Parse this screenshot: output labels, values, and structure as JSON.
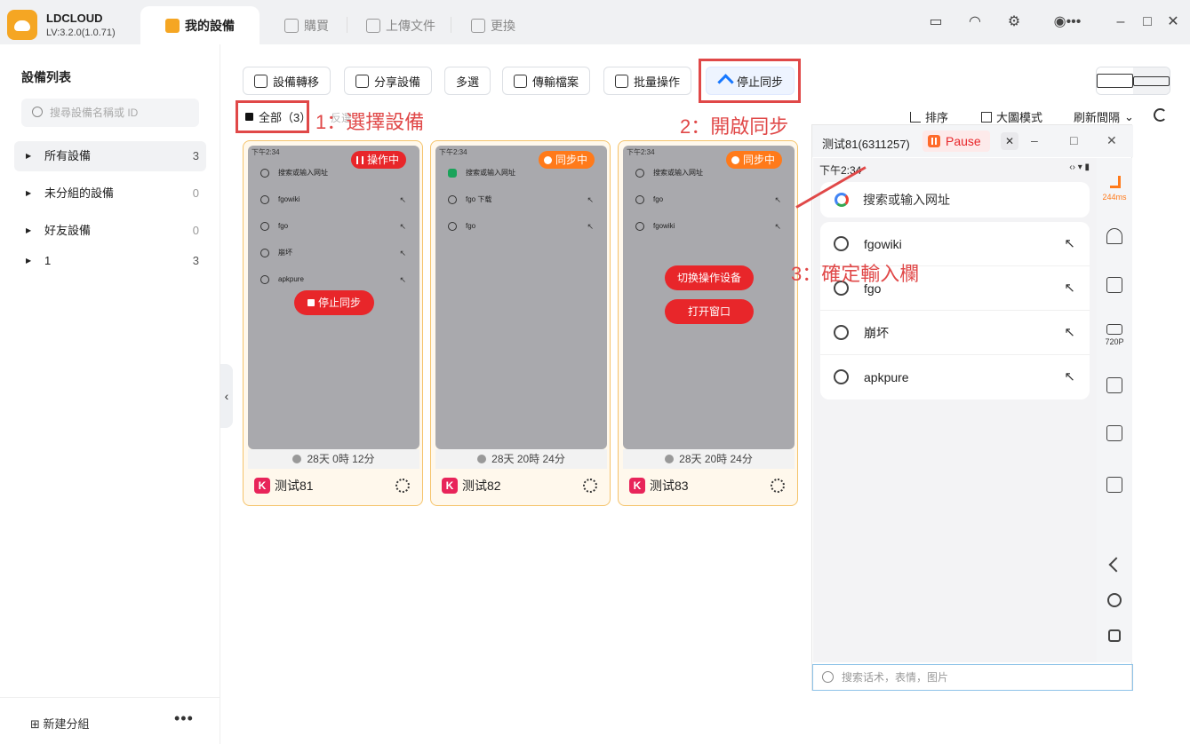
{
  "app": {
    "name": "LDCLOUD",
    "version": "LV:3.2.0(1.0.71)"
  },
  "tabs": [
    {
      "label": "我的設備"
    },
    {
      "label": "購買"
    },
    {
      "label": "上傳文件"
    },
    {
      "label": "更換"
    }
  ],
  "sidebar": {
    "title": "設備列表",
    "search_placeholder": "搜尋設備名稱或 ID",
    "items": [
      {
        "label": "所有設備",
        "count": "3"
      },
      {
        "label": "未分組的設備",
        "count": "0"
      },
      {
        "label": "好友設備",
        "count": "0"
      },
      {
        "label": "1",
        "count": "3"
      }
    ],
    "new_group": "新建分組",
    "more": "•••"
  },
  "toolbar": {
    "transfer": "設備轉移",
    "share": "分享設備",
    "multi": "多選",
    "upload": "傳輸檔案",
    "batch": "批量操作",
    "stop_sync": "停止同步"
  },
  "select": {
    "all": "全部（3）",
    "invert": "反選"
  },
  "annotations": {
    "step1": "1：選擇設備",
    "step2": "2：開啟同步",
    "step3": "3：確定輸入欄"
  },
  "sort_bar": {
    "sort": "排序",
    "big_mode": "大圖模式",
    "refresh_interval": "刷新間隔"
  },
  "cards": [
    {
      "name": "测试81",
      "uptime": "28天 0時 12分",
      "badge": "操作中",
      "status_time": "下午2:34",
      "search": "搜索或输入网址",
      "rows": [
        "fgowiki",
        "fgo",
        "崩坏",
        "apkpure"
      ],
      "button": "停止同步"
    },
    {
      "name": "测试82",
      "uptime": "28天 20時 24分",
      "badge": "同步中",
      "status_time": "下午2:34",
      "search": "搜索或输入网址",
      "rows": [
        "fgo 下载",
        "fgo"
      ]
    },
    {
      "name": "测试83",
      "uptime": "28天 20時 24分",
      "badge": "同步中",
      "status_time": "下午2:34",
      "search": "搜索或输入网址",
      "rows": [
        "fgo",
        "fgowiki"
      ],
      "button_switch": "切换操作设备",
      "button_open": "打开窗口"
    }
  ],
  "device_window": {
    "title": "测试81(6311257)",
    "pause": "Pause",
    "time": "下午2:34",
    "status_icons": "‹› ▾ ▮",
    "search": "搜索或输入网址",
    "rows": [
      "fgowiki",
      "fgo",
      "崩坏",
      "apkpure"
    ],
    "latency": "244ms",
    "quality": "720P",
    "input_placeholder": "搜索话术，表情，图片"
  }
}
